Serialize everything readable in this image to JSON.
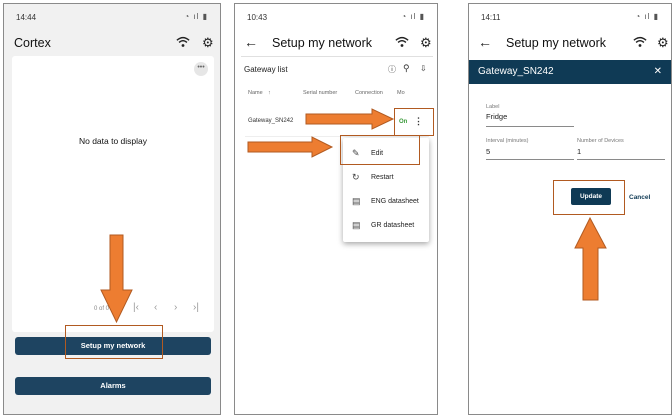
{
  "colors": {
    "navy": "#1e4461",
    "dialog_navy": "#0f3a55",
    "arrow": "#ed7d31",
    "arrow_border": "#b15a21",
    "online": "#3a9a3a"
  },
  "screen1": {
    "time": "14:44",
    "title": "Cortex",
    "empty_text": "No data to display",
    "pager_text": "0 of 0",
    "setup_button": "Setup my network",
    "alarms_button": "Alarms"
  },
  "screen2": {
    "time": "10:43",
    "title": "Setup my network",
    "list_title": "Gateway list",
    "headers": {
      "name": "Name",
      "serial": "Serial number",
      "connection": "Connection",
      "mode": "Mo"
    },
    "row": {
      "name": "Gateway_SN242",
      "status": "On"
    },
    "menu": [
      {
        "label": "Edit",
        "icon": "pencil-icon"
      },
      {
        "label": "Restart",
        "icon": "restart-icon"
      },
      {
        "label": "ENG datasheet",
        "icon": "datasheet-icon"
      },
      {
        "label": "GR datasheet",
        "icon": "datasheet-icon"
      }
    ]
  },
  "screen3": {
    "time": "14:11",
    "title": "Setup my network",
    "dialog_title": "Gateway_SN242",
    "label_field": {
      "label": "Label",
      "value": "Fridge"
    },
    "interval_field": {
      "label": "Interval (minutes)",
      "value": "5"
    },
    "devices_field": {
      "label": "Number of Devices",
      "value": "1"
    },
    "update_button": "Update",
    "cancel_button": "Cancel"
  }
}
